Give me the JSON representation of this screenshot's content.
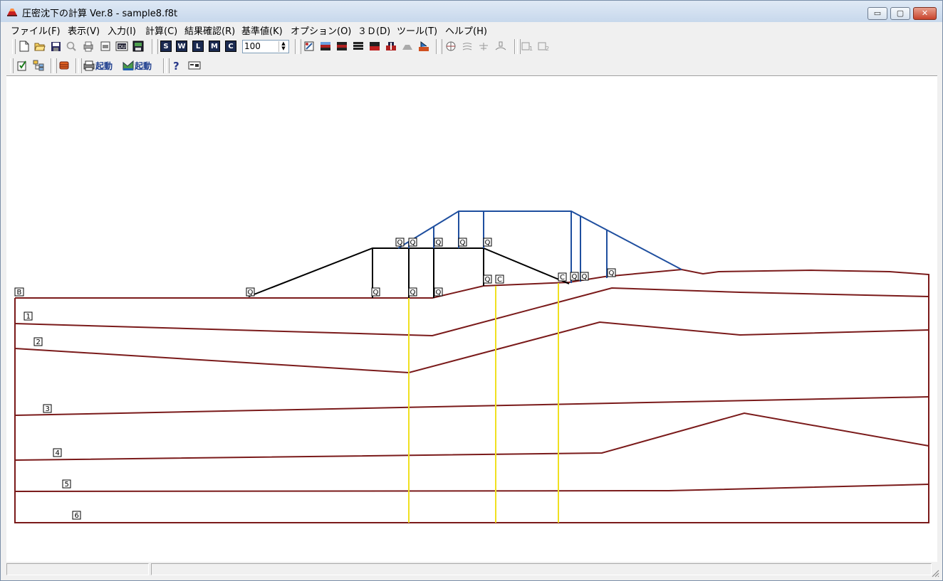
{
  "window": {
    "title": "圧密沈下の計算 Ver.8 - sample8.f8t",
    "buttons": {
      "minimize": "▭",
      "maximize": "▢",
      "close": "✕"
    }
  },
  "menu": [
    "ファイル(F)",
    "表示(V)",
    "入力(I)",
    "計算(C)",
    "結果確認(R)",
    "基準値(K)",
    "オプション(O)",
    "３Ｄ(D)",
    "ツール(T)",
    "ヘルプ(H)"
  ],
  "toolbar": {
    "letter_buttons": [
      "S",
      "W",
      "L",
      "M",
      "C"
    ],
    "zoom_value": "100",
    "start_label_1": "起動",
    "start_label_2": "起動"
  },
  "diagram": {
    "soil_layer_labels": [
      "1",
      "2",
      "3",
      "4",
      "5",
      "6"
    ],
    "base_label": "B",
    "load_marker": "Q",
    "point_marker": "C",
    "colors": {
      "layer_lines": "#7a1a1a",
      "embankment_1": "#000000",
      "embankment_2": "#1f4f9f",
      "calc_lines": "#f0e020"
    }
  }
}
